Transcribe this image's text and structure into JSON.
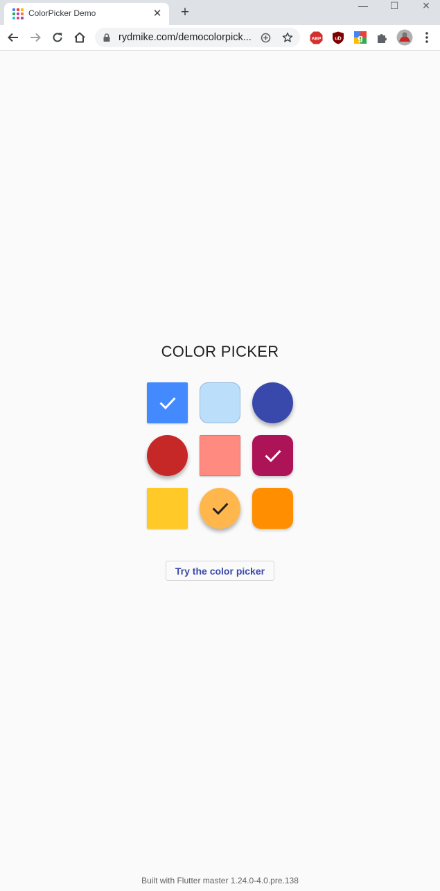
{
  "browser": {
    "tab_title": "ColorPicker Demo",
    "tab_close_glyph": "✕",
    "new_tab_glyph": "+",
    "url": "rydmike.com/democolorpick...",
    "window_controls": {
      "minimize": "—",
      "maximize": "☐",
      "close": "✕"
    },
    "favicon_colors": [
      "#4285f4",
      "#ea4335",
      "#fbbc05",
      "#34a853",
      "#ab47bc",
      "#ff7043",
      "#26c6da",
      "#ec407a",
      "#7e57c2"
    ],
    "extensions": [
      {
        "name": "abp-icon",
        "label": "ABP",
        "color": "#d32f2f"
      },
      {
        "name": "ublock-icon",
        "label": "uD",
        "color": "#800000"
      },
      {
        "name": "google-translate-icon",
        "label": "G",
        "color": "#4285f4"
      },
      {
        "name": "puzzle-icon",
        "label": "",
        "color": "#5f6368"
      },
      {
        "name": "avatar",
        "label": "",
        "color": "#9e9e9e"
      }
    ]
  },
  "page": {
    "heading": "COLOR PICKER",
    "swatches": [
      {
        "name": "swatch-blue",
        "color": "#448aff",
        "shape": "square",
        "checked": true,
        "check_color": "#ffffff"
      },
      {
        "name": "swatch-light-blue",
        "color": "#bbdefb",
        "shape": "rounded",
        "checked": false
      },
      {
        "name": "swatch-indigo",
        "color": "#3949ab",
        "shape": "circle",
        "checked": false
      },
      {
        "name": "swatch-red",
        "color": "#c62828",
        "shape": "circle",
        "checked": false
      },
      {
        "name": "swatch-salmon",
        "color": "#ff8a80",
        "shape": "square",
        "checked": false
      },
      {
        "name": "swatch-magenta",
        "color": "#ad1457",
        "shape": "rounded",
        "checked": true,
        "check_color": "#ffffff"
      },
      {
        "name": "swatch-amber",
        "color": "#ffca28",
        "shape": "square",
        "checked": false
      },
      {
        "name": "swatch-light-orange",
        "color": "#ffb74d",
        "shape": "circle",
        "checked": true,
        "check_color": "#212121"
      },
      {
        "name": "swatch-orange",
        "color": "#ff8f00",
        "shape": "rounded",
        "checked": false
      }
    ],
    "button_label": "Try the color picker",
    "footer": "Built with Flutter master 1.24.0-4.0.pre.138"
  }
}
